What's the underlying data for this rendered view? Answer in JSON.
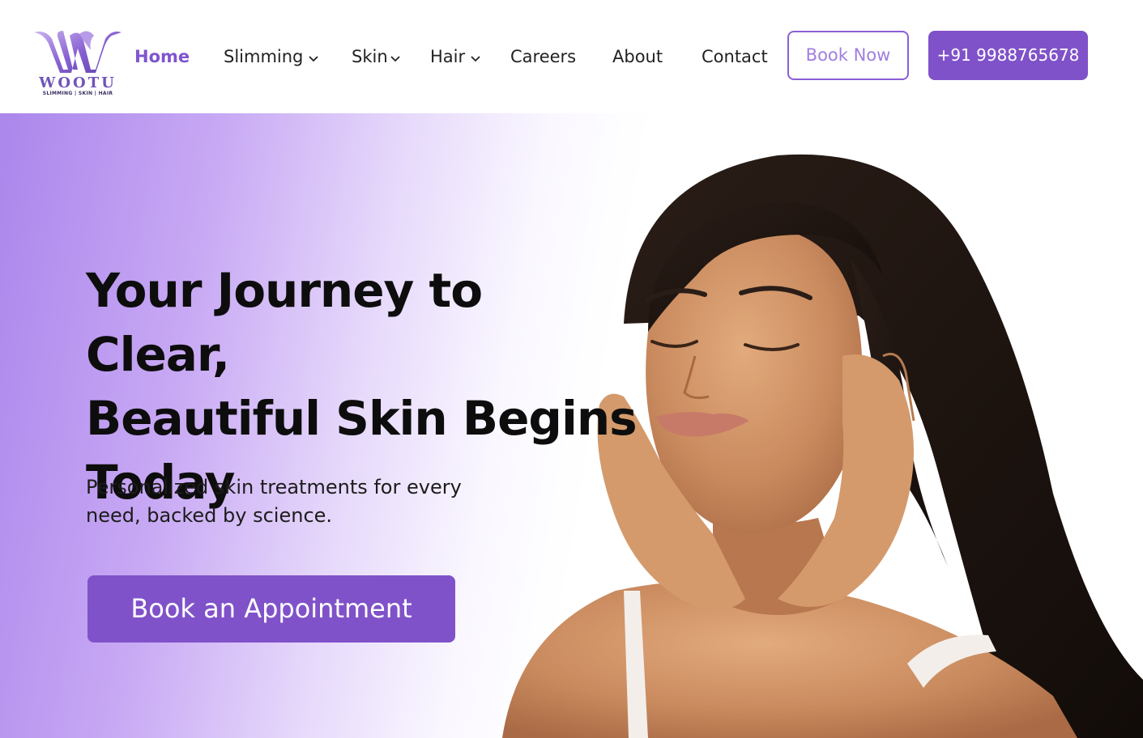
{
  "brand": {
    "name": "WOOTU",
    "tagline": "SLIMMING | SKIN | HAIR",
    "colors": {
      "primary": "#8052c9",
      "accent": "#9f7ee0",
      "gradient_start": "#ab86ec"
    }
  },
  "nav": {
    "items": [
      {
        "label": "Home",
        "active": true,
        "dropdown": false
      },
      {
        "label": "Slimming",
        "active": false,
        "dropdown": true
      },
      {
        "label": "Skin",
        "active": false,
        "dropdown": true
      },
      {
        "label": "Hair",
        "active": false,
        "dropdown": true
      },
      {
        "label": "Careers",
        "active": false,
        "dropdown": false
      },
      {
        "label": "About",
        "active": false,
        "dropdown": false
      },
      {
        "label": "Contact",
        "active": false,
        "dropdown": false
      }
    ],
    "book_now_label": "Book Now",
    "phone_label": "+91 9988765678"
  },
  "hero": {
    "title_line1": "Your Journey to Clear,",
    "title_line2": "Beautiful Skin Begins",
    "title_line3": "Today",
    "subtitle_line1": "Personalized skin treatments for every",
    "subtitle_line2": "need, backed by science.",
    "cta_label": "Book an Appointment",
    "image_icon": "woman-portrait-photo"
  }
}
